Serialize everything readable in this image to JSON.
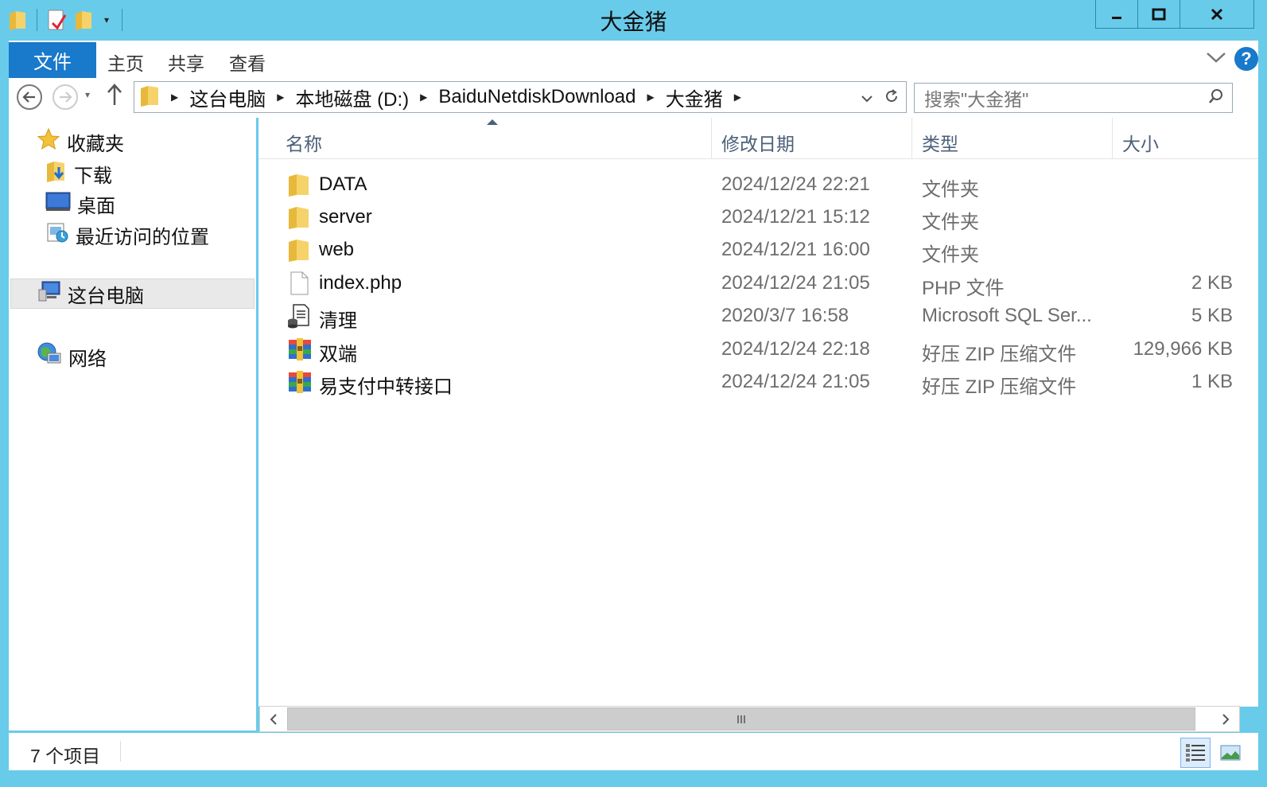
{
  "window": {
    "title": "大金猪"
  },
  "ribbon": {
    "tabs": [
      "文件",
      "主页",
      "共享",
      "查看"
    ],
    "help_label": "?"
  },
  "address": {
    "crumbs": [
      "这台电脑",
      "本地磁盘 (D:)",
      "BaiduNetdiskDownload",
      "大金猪"
    ]
  },
  "search": {
    "placeholder": "搜索\"大金猪\""
  },
  "navpane": {
    "favorites": "收藏夹",
    "downloads": "下载",
    "desktop": "桌面",
    "recent": "最近访问的位置",
    "this_pc": "这台电脑",
    "network": "网络"
  },
  "columns": {
    "name": "名称",
    "date": "修改日期",
    "type": "类型",
    "size": "大小"
  },
  "files": [
    {
      "name": "DATA",
      "date": "2024/12/24 22:21",
      "type": "文件夹",
      "size": "",
      "icon": "folder-icon"
    },
    {
      "name": "server",
      "date": "2024/12/21 15:12",
      "type": "文件夹",
      "size": "",
      "icon": "folder-icon"
    },
    {
      "name": "web",
      "date": "2024/12/21 16:00",
      "type": "文件夹",
      "size": "",
      "icon": "folder-icon"
    },
    {
      "name": "index.php",
      "date": "2024/12/24 21:05",
      "type": "PHP 文件",
      "size": "2 KB",
      "icon": "document-icon"
    },
    {
      "name": "清理",
      "date": "2020/3/7 16:58",
      "type": "Microsoft SQL Ser...",
      "size": "5 KB",
      "icon": "sql-file-icon"
    },
    {
      "name": "双端",
      "date": "2024/12/24 22:18",
      "type": "好压 ZIP 压缩文件",
      "size": "129,966 KB",
      "icon": "zip-archive-icon"
    },
    {
      "name": "易支付中转接口",
      "date": "2024/12/24 21:05",
      "type": "好压 ZIP 压缩文件",
      "size": "1 KB",
      "icon": "zip-archive-icon"
    }
  ],
  "status": {
    "item_count": "7 个项目"
  },
  "colors": {
    "frame": "#69cbea",
    "accent": "#1979ca",
    "header_text": "#4c6079"
  }
}
